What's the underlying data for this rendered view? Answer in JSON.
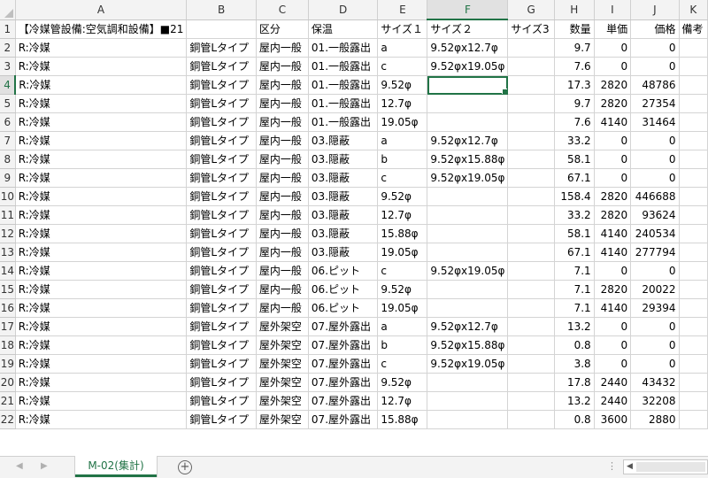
{
  "columns": [
    "A",
    "B",
    "C",
    "D",
    "E",
    "F",
    "G",
    "H",
    "I",
    "J",
    "K"
  ],
  "active_column": "F",
  "active_row": 4,
  "rows": [
    {
      "n": 1,
      "cells": [
        "【冷媒管設備:空気調和設備】■21",
        "",
        "区分",
        "保温",
        "サイズ１",
        "サイズ２",
        "サイズ3",
        "数量",
        "単価",
        "価格",
        "備考"
      ]
    },
    {
      "n": 2,
      "cells": [
        "R:冷媒",
        "銅管Lタイプ",
        "屋内一般",
        "01.一般露出",
        "a",
        "9.52φx12.7φ",
        "",
        "9.7",
        "0",
        "0",
        ""
      ]
    },
    {
      "n": 3,
      "cells": [
        "R:冷媒",
        "銅管Lタイプ",
        "屋内一般",
        "01.一般露出",
        "c",
        "9.52φx19.05φ",
        "",
        "7.6",
        "0",
        "0",
        ""
      ]
    },
    {
      "n": 4,
      "cells": [
        "R:冷媒",
        "銅管Lタイプ",
        "屋内一般",
        "01.一般露出",
        "9.52φ",
        "",
        "",
        "17.3",
        "2820",
        "48786",
        ""
      ]
    },
    {
      "n": 5,
      "cells": [
        "R:冷媒",
        "銅管Lタイプ",
        "屋内一般",
        "01.一般露出",
        "12.7φ",
        "",
        "",
        "9.7",
        "2820",
        "27354",
        ""
      ]
    },
    {
      "n": 6,
      "cells": [
        "R:冷媒",
        "銅管Lタイプ",
        "屋内一般",
        "01.一般露出",
        "19.05φ",
        "",
        "",
        "7.6",
        "4140",
        "31464",
        ""
      ]
    },
    {
      "n": 7,
      "cells": [
        "R:冷媒",
        "銅管Lタイプ",
        "屋内一般",
        "03.隠蔽",
        "a",
        "9.52φx12.7φ",
        "",
        "33.2",
        "0",
        "0",
        ""
      ]
    },
    {
      "n": 8,
      "cells": [
        "R:冷媒",
        "銅管Lタイプ",
        "屋内一般",
        "03.隠蔽",
        "b",
        "9.52φx15.88φ",
        "",
        "58.1",
        "0",
        "0",
        ""
      ]
    },
    {
      "n": 9,
      "cells": [
        "R:冷媒",
        "銅管Lタイプ",
        "屋内一般",
        "03.隠蔽",
        "c",
        "9.52φx19.05φ",
        "",
        "67.1",
        "0",
        "0",
        ""
      ]
    },
    {
      "n": 10,
      "cells": [
        "R:冷媒",
        "銅管Lタイプ",
        "屋内一般",
        "03.隠蔽",
        "9.52φ",
        "",
        "",
        "158.4",
        "2820",
        "446688",
        ""
      ]
    },
    {
      "n": 11,
      "cells": [
        "R:冷媒",
        "銅管Lタイプ",
        "屋内一般",
        "03.隠蔽",
        "12.7φ",
        "",
        "",
        "33.2",
        "2820",
        "93624",
        ""
      ]
    },
    {
      "n": 12,
      "cells": [
        "R:冷媒",
        "銅管Lタイプ",
        "屋内一般",
        "03.隠蔽",
        "15.88φ",
        "",
        "",
        "58.1",
        "4140",
        "240534",
        ""
      ]
    },
    {
      "n": 13,
      "cells": [
        "R:冷媒",
        "銅管Lタイプ",
        "屋内一般",
        "03.隠蔽",
        "19.05φ",
        "",
        "",
        "67.1",
        "4140",
        "277794",
        ""
      ]
    },
    {
      "n": 14,
      "cells": [
        "R:冷媒",
        "銅管Lタイプ",
        "屋内一般",
        "06.ピット",
        "c",
        "9.52φx19.05φ",
        "",
        "7.1",
        "0",
        "0",
        ""
      ]
    },
    {
      "n": 15,
      "cells": [
        "R:冷媒",
        "銅管Lタイプ",
        "屋内一般",
        "06.ピット",
        "9.52φ",
        "",
        "",
        "7.1",
        "2820",
        "20022",
        ""
      ]
    },
    {
      "n": 16,
      "cells": [
        "R:冷媒",
        "銅管Lタイプ",
        "屋内一般",
        "06.ピット",
        "19.05φ",
        "",
        "",
        "7.1",
        "4140",
        "29394",
        ""
      ]
    },
    {
      "n": 17,
      "cells": [
        "R:冷媒",
        "銅管Lタイプ",
        "屋外架空",
        "07.屋外露出",
        "a",
        "9.52φx12.7φ",
        "",
        "13.2",
        "0",
        "0",
        ""
      ]
    },
    {
      "n": 18,
      "cells": [
        "R:冷媒",
        "銅管Lタイプ",
        "屋外架空",
        "07.屋外露出",
        "b",
        "9.52φx15.88φ",
        "",
        "0.8",
        "0",
        "0",
        ""
      ]
    },
    {
      "n": 19,
      "cells": [
        "R:冷媒",
        "銅管Lタイプ",
        "屋外架空",
        "07.屋外露出",
        "c",
        "9.52φx19.05φ",
        "",
        "3.8",
        "0",
        "0",
        ""
      ]
    },
    {
      "n": 20,
      "cells": [
        "R:冷媒",
        "銅管Lタイプ",
        "屋外架空",
        "07.屋外露出",
        "9.52φ",
        "",
        "",
        "17.8",
        "2440",
        "43432",
        ""
      ]
    },
    {
      "n": 21,
      "cells": [
        "R:冷媒",
        "銅管Lタイプ",
        "屋外架空",
        "07.屋外露出",
        "12.7φ",
        "",
        "",
        "13.2",
        "2440",
        "32208",
        ""
      ]
    },
    {
      "n": 22,
      "cells": [
        "R:冷媒",
        "銅管Lタイプ",
        "屋外架空",
        "07.屋外露出",
        "15.88φ",
        "",
        "",
        "0.8",
        "3600",
        "2880",
        ""
      ]
    }
  ],
  "tabs": {
    "prev": "◀",
    "next": "▶",
    "active_sheet": "M-02(集計)",
    "add_sheet": "+",
    "split_handle": "⋮",
    "scroll_left": "◀"
  },
  "colors": {
    "accent": "#217346",
    "header_bg": "#f3f3f3",
    "gridline": "#d4d4d4"
  }
}
